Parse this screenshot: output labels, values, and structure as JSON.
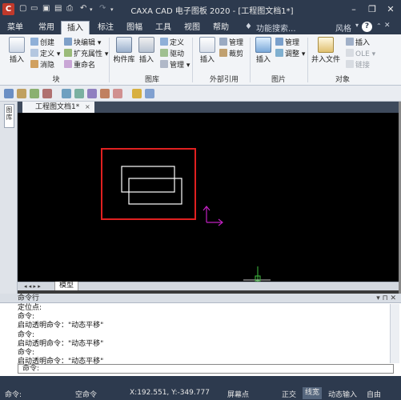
{
  "title_bar": {
    "logo": "C",
    "title": "CAXA CAD 电子图板 2020 - [工程图文档1*]",
    "quick_access": [
      "new-file-icon",
      "open-folder-icon",
      "save-icon",
      "save-as-icon",
      "print-icon",
      "undo-icon",
      "redo-icon",
      "dropdown-icon"
    ],
    "controls": {
      "minimize": "–",
      "restore": "❐",
      "close": "✕"
    }
  },
  "ribbon_tabs": [
    "菜单",
    "常用",
    "插入",
    "标注",
    "图幅",
    "工具",
    "视图",
    "帮助"
  ],
  "active_tab": "插入",
  "search_placeholder": "功能搜索...",
  "style": {
    "label": "风格",
    "help": "?"
  },
  "ribbon": {
    "block": {
      "label": "块",
      "insert": "插入",
      "create": "创建",
      "define": "定义",
      "eliminate": "消隐",
      "block_edit": "块编辑",
      "ext_attr": "扩充属性",
      "rename": "重命名"
    },
    "library": {
      "label": "图库",
      "parts_lib": "构件库",
      "insert": "插入",
      "define": "定义",
      "drive": "驱动",
      "manage": "管理"
    },
    "xref": {
      "label": "外部引用",
      "insert": "插入",
      "manage": "管理",
      "clip": "裁剪"
    },
    "image": {
      "label": "图片",
      "insert": "插入",
      "manage": "管理",
      "adjust": "调整"
    },
    "object": {
      "label": "对象",
      "insert_file": "并入文件",
      "insert": "插入",
      "ole": "OLE",
      "link": "链接"
    }
  },
  "side_panel": {
    "tab_label": "图库"
  },
  "document": {
    "tab": "工程图文档1*",
    "close": "×"
  },
  "layout_tabs": {
    "nav": "◂ ◂ ▸ ▸",
    "model": "模型"
  },
  "command_panel": {
    "title": "命令行",
    "header_icons": "▾ ⊓ ✕",
    "log": [
      "定位点:",
      "命令:",
      "启动透明命令：\"动态平移\"",
      "命令:",
      "启动透明命令：\"动态平移\"",
      "命令:",
      "启动透明命令：\"动态平移\""
    ],
    "prompt": "命令:"
  },
  "status_bar": {
    "left": "命令:",
    "mode": "空命令",
    "coords": "X:192.551, Y:-349.777",
    "snap": "屏幕点",
    "ortho": "正交",
    "lineweight": "线宽",
    "dyn_input": "动态输入",
    "free": "自由"
  },
  "colors": {
    "accent": "#2d3a4e",
    "selection_box": "#e02020",
    "ucs_axis": "#c020c0",
    "origin": "#40c040"
  }
}
